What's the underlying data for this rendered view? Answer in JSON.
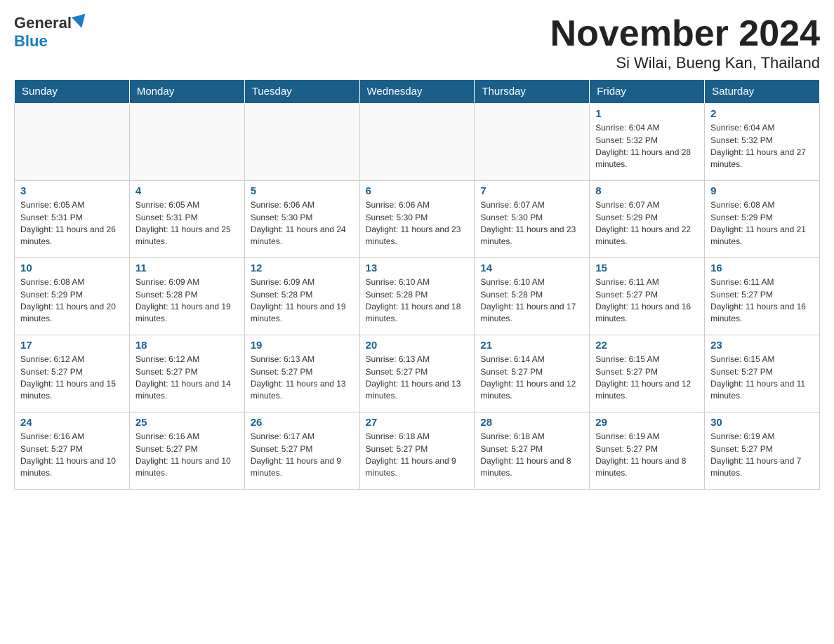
{
  "header": {
    "logo_general": "General",
    "logo_blue": "Blue",
    "month_title": "November 2024",
    "subtitle": "Si Wilai, Bueng Kan, Thailand"
  },
  "weekdays": [
    "Sunday",
    "Monday",
    "Tuesday",
    "Wednesday",
    "Thursday",
    "Friday",
    "Saturday"
  ],
  "weeks": [
    [
      {
        "day": "",
        "info": ""
      },
      {
        "day": "",
        "info": ""
      },
      {
        "day": "",
        "info": ""
      },
      {
        "day": "",
        "info": ""
      },
      {
        "day": "",
        "info": ""
      },
      {
        "day": "1",
        "info": "Sunrise: 6:04 AM\nSunset: 5:32 PM\nDaylight: 11 hours and 28 minutes."
      },
      {
        "day": "2",
        "info": "Sunrise: 6:04 AM\nSunset: 5:32 PM\nDaylight: 11 hours and 27 minutes."
      }
    ],
    [
      {
        "day": "3",
        "info": "Sunrise: 6:05 AM\nSunset: 5:31 PM\nDaylight: 11 hours and 26 minutes."
      },
      {
        "day": "4",
        "info": "Sunrise: 6:05 AM\nSunset: 5:31 PM\nDaylight: 11 hours and 25 minutes."
      },
      {
        "day": "5",
        "info": "Sunrise: 6:06 AM\nSunset: 5:30 PM\nDaylight: 11 hours and 24 minutes."
      },
      {
        "day": "6",
        "info": "Sunrise: 6:06 AM\nSunset: 5:30 PM\nDaylight: 11 hours and 23 minutes."
      },
      {
        "day": "7",
        "info": "Sunrise: 6:07 AM\nSunset: 5:30 PM\nDaylight: 11 hours and 23 minutes."
      },
      {
        "day": "8",
        "info": "Sunrise: 6:07 AM\nSunset: 5:29 PM\nDaylight: 11 hours and 22 minutes."
      },
      {
        "day": "9",
        "info": "Sunrise: 6:08 AM\nSunset: 5:29 PM\nDaylight: 11 hours and 21 minutes."
      }
    ],
    [
      {
        "day": "10",
        "info": "Sunrise: 6:08 AM\nSunset: 5:29 PM\nDaylight: 11 hours and 20 minutes."
      },
      {
        "day": "11",
        "info": "Sunrise: 6:09 AM\nSunset: 5:28 PM\nDaylight: 11 hours and 19 minutes."
      },
      {
        "day": "12",
        "info": "Sunrise: 6:09 AM\nSunset: 5:28 PM\nDaylight: 11 hours and 19 minutes."
      },
      {
        "day": "13",
        "info": "Sunrise: 6:10 AM\nSunset: 5:28 PM\nDaylight: 11 hours and 18 minutes."
      },
      {
        "day": "14",
        "info": "Sunrise: 6:10 AM\nSunset: 5:28 PM\nDaylight: 11 hours and 17 minutes."
      },
      {
        "day": "15",
        "info": "Sunrise: 6:11 AM\nSunset: 5:27 PM\nDaylight: 11 hours and 16 minutes."
      },
      {
        "day": "16",
        "info": "Sunrise: 6:11 AM\nSunset: 5:27 PM\nDaylight: 11 hours and 16 minutes."
      }
    ],
    [
      {
        "day": "17",
        "info": "Sunrise: 6:12 AM\nSunset: 5:27 PM\nDaylight: 11 hours and 15 minutes."
      },
      {
        "day": "18",
        "info": "Sunrise: 6:12 AM\nSunset: 5:27 PM\nDaylight: 11 hours and 14 minutes."
      },
      {
        "day": "19",
        "info": "Sunrise: 6:13 AM\nSunset: 5:27 PM\nDaylight: 11 hours and 13 minutes."
      },
      {
        "day": "20",
        "info": "Sunrise: 6:13 AM\nSunset: 5:27 PM\nDaylight: 11 hours and 13 minutes."
      },
      {
        "day": "21",
        "info": "Sunrise: 6:14 AM\nSunset: 5:27 PM\nDaylight: 11 hours and 12 minutes."
      },
      {
        "day": "22",
        "info": "Sunrise: 6:15 AM\nSunset: 5:27 PM\nDaylight: 11 hours and 12 minutes."
      },
      {
        "day": "23",
        "info": "Sunrise: 6:15 AM\nSunset: 5:27 PM\nDaylight: 11 hours and 11 minutes."
      }
    ],
    [
      {
        "day": "24",
        "info": "Sunrise: 6:16 AM\nSunset: 5:27 PM\nDaylight: 11 hours and 10 minutes."
      },
      {
        "day": "25",
        "info": "Sunrise: 6:16 AM\nSunset: 5:27 PM\nDaylight: 11 hours and 10 minutes."
      },
      {
        "day": "26",
        "info": "Sunrise: 6:17 AM\nSunset: 5:27 PM\nDaylight: 11 hours and 9 minutes."
      },
      {
        "day": "27",
        "info": "Sunrise: 6:18 AM\nSunset: 5:27 PM\nDaylight: 11 hours and 9 minutes."
      },
      {
        "day": "28",
        "info": "Sunrise: 6:18 AM\nSunset: 5:27 PM\nDaylight: 11 hours and 8 minutes."
      },
      {
        "day": "29",
        "info": "Sunrise: 6:19 AM\nSunset: 5:27 PM\nDaylight: 11 hours and 8 minutes."
      },
      {
        "day": "30",
        "info": "Sunrise: 6:19 AM\nSunset: 5:27 PM\nDaylight: 11 hours and 7 minutes."
      }
    ]
  ]
}
